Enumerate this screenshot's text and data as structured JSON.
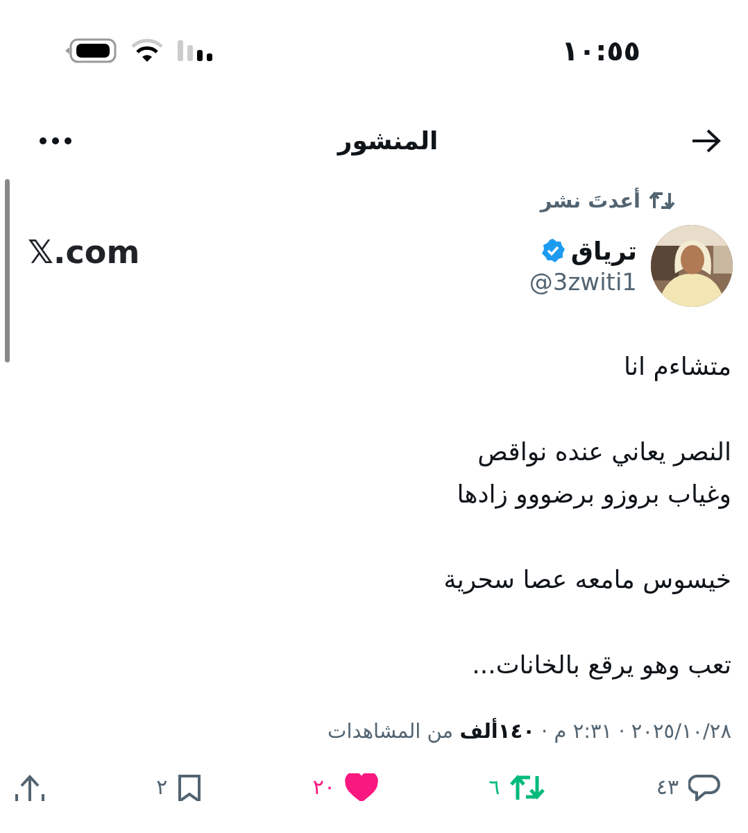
{
  "status_bar": {
    "time": "١٠:٥٥"
  },
  "header": {
    "title": "المنشور"
  },
  "repost_label": "أعدتَ نشر",
  "author": {
    "name": "ترياق",
    "verified": true,
    "handle": "@3zwiti1"
  },
  "source_link": "𝕏.com",
  "tweet_paragraphs": [
    [
      "متشاءم انا"
    ],
    [
      "النصر يعاني عنده نواقص",
      "وغياب بروزو برضووو زادها"
    ],
    [
      "خيسوس مامعه عصا سحرية"
    ],
    [
      "تعب وهو يرقع بالخانات..."
    ]
  ],
  "meta": "٢٠٢٥/١٠/٢٨ · ٢:٣١ م · **١٤٠ألف** من المشاهدات",
  "actions": [
    {
      "kind": "reply",
      "count": "٤٣",
      "selected": false
    },
    {
      "kind": "repost",
      "count": "٦",
      "selected": true
    },
    {
      "kind": "like",
      "count": "٢٠",
      "selected": true
    },
    {
      "kind": "bookmark",
      "count": "٢",
      "selected": false
    },
    {
      "kind": "share",
      "selected": false
    }
  ]
}
